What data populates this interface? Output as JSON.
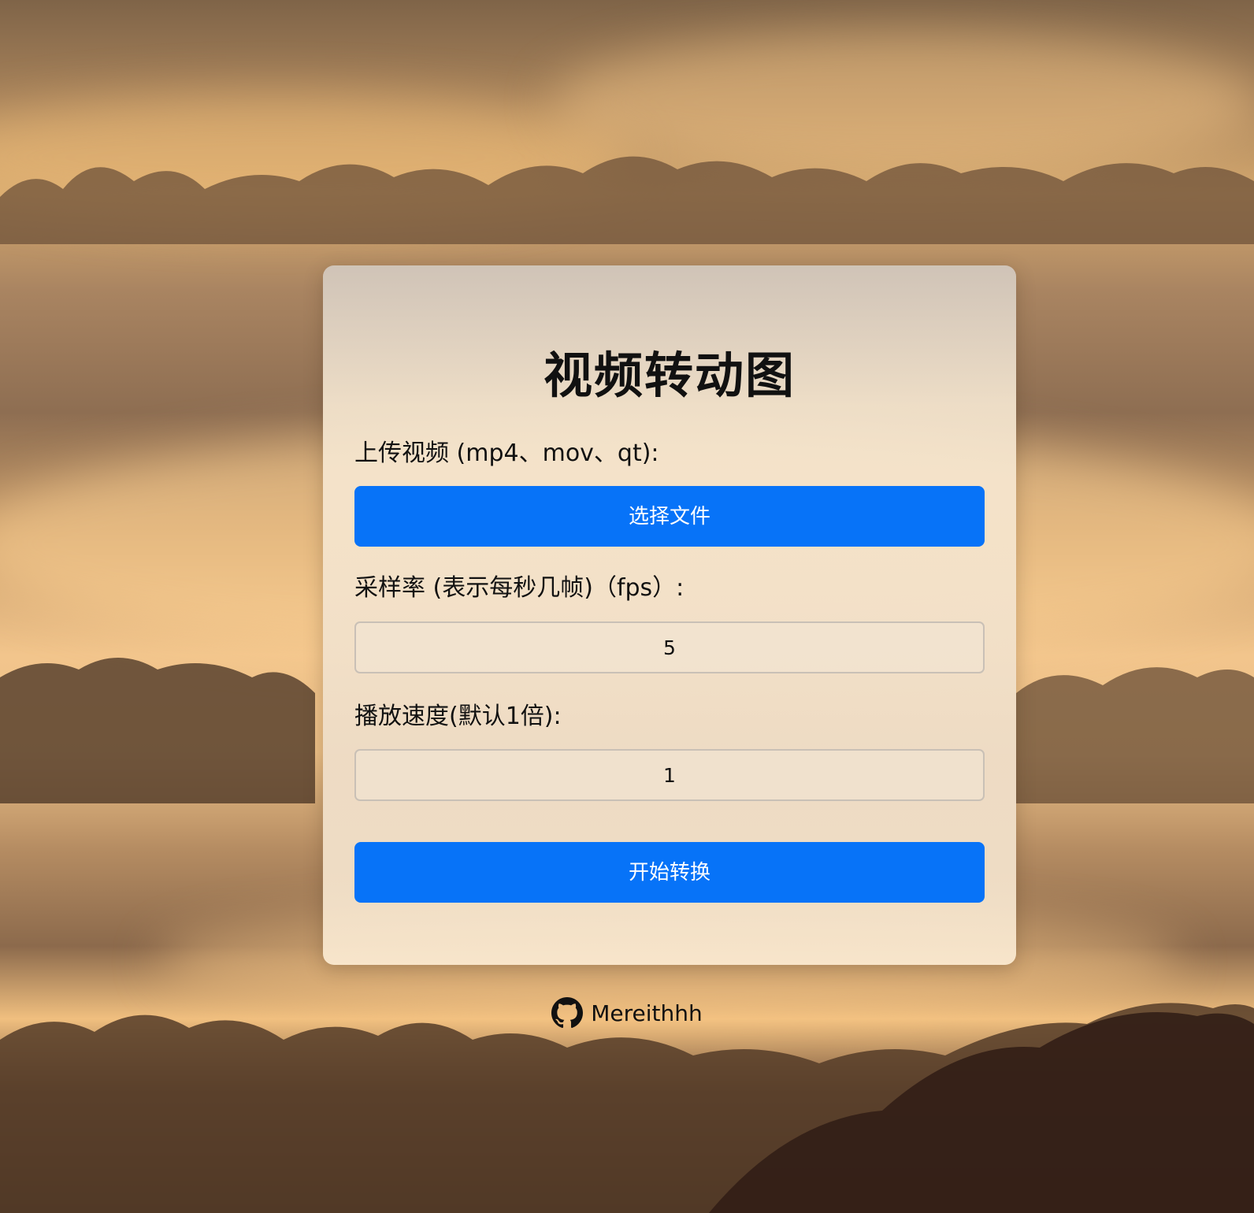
{
  "form": {
    "title": "视频转动图",
    "upload_label": "上传视频 (mp4、mov、qt):",
    "choose_file_button": "选择文件",
    "fps_label": "采样率 (表示每秒几帧)（fps）:",
    "fps_value": "5",
    "speed_label": "播放速度(默认1倍):",
    "speed_value": "1",
    "convert_button": "开始转换"
  },
  "footer": {
    "author": "Mereithhh",
    "icon": "github-icon"
  },
  "colors": {
    "accent": "#0773f8",
    "card_bg": "#f2e3cf"
  }
}
